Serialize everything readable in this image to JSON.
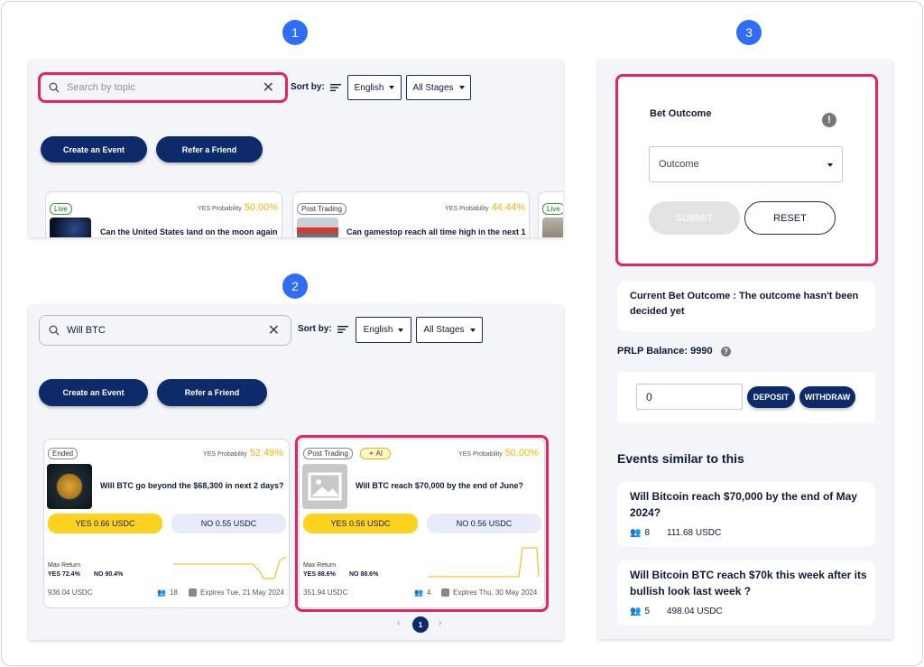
{
  "steps": [
    "1",
    "2",
    "3"
  ],
  "colors": {
    "accent": "#2f6df6",
    "highlight": "#e8245c",
    "navy": "#0d2a6b",
    "yes": "#ffd21f",
    "prob": "#f5b400"
  },
  "panel1": {
    "search_placeholder": "Search by topic",
    "sort_label": "Sort by:",
    "language": "English",
    "stages": "All Stages",
    "create_event": "Create an Event",
    "refer_friend": "Refer a Friend",
    "cards": [
      {
        "badge": "Live",
        "prob_label": "YES Probability",
        "prob": "50.00%",
        "title": "Can the United States land on the moon again"
      },
      {
        "badge": "Post Trading",
        "prob_label": "YES Probability",
        "prob": "44.44%",
        "title": "Can gamestop reach all time high in the next 1"
      },
      {
        "badge": "Live"
      }
    ]
  },
  "panel2": {
    "search_value": "Will BTC",
    "sort_label": "Sort by:",
    "language": "English",
    "stages": "All Stages",
    "create_event": "Create an Event",
    "refer_friend": "Refer a Friend",
    "cards": [
      {
        "badge": "Ended",
        "prob_label": "YES Probability",
        "prob": "52.49%",
        "title": "Will BTC go beyond the $68,300 in next 2 days?",
        "yes_btn": "YES 0.66 USDC",
        "no_btn": "NO 0.55 USDC",
        "max_return": "Max Return",
        "yes_ret": "YES 72.4%",
        "no_ret": "NO 90.4%",
        "volume": "936.04 USDC",
        "participants": "18",
        "expires": "Expires Tue, 21 May 2024"
      },
      {
        "badge": "Post Trading",
        "ai_badge": "AI",
        "prob_label": "YES Probability",
        "prob": "50.00%",
        "title": "Will BTC reach $70,000 by the end of June?",
        "yes_btn": "YES 0.56 USDC",
        "no_btn": "NO 0.56 USDC",
        "max_return": "Max Return",
        "yes_ret": "YES 88.6%",
        "no_ret": "NO 88.6%",
        "volume": "351.94 USDC",
        "participants": "4",
        "expires": "Expires Thu, 30 May 2024"
      }
    ],
    "pagination": {
      "prev": "‹",
      "current": "1",
      "next": "›"
    }
  },
  "panel3": {
    "bet_outcome_title": "Bet Outcome",
    "outcome_select": "Outcome",
    "submit": "SUBMIT",
    "reset": "RESET",
    "current_outcome": "Current Bet Outcome : The outcome hasn't been decided yet",
    "balance": "PRLP Balance: 9990",
    "amount_value": "0",
    "deposit": "DEPOSIT",
    "withdraw": "WITHDRAW",
    "similar_title": "Events similar to this",
    "similar": [
      {
        "title": "Will Bitcoin reach $70,000 by the end of May 2024?",
        "participants": "8",
        "volume": "111.68 USDC"
      },
      {
        "title": "Will Bitcoin BTC reach $70k this week after its bullish look last week ?",
        "participants": "5",
        "volume": "498.04 USDC"
      }
    ]
  }
}
